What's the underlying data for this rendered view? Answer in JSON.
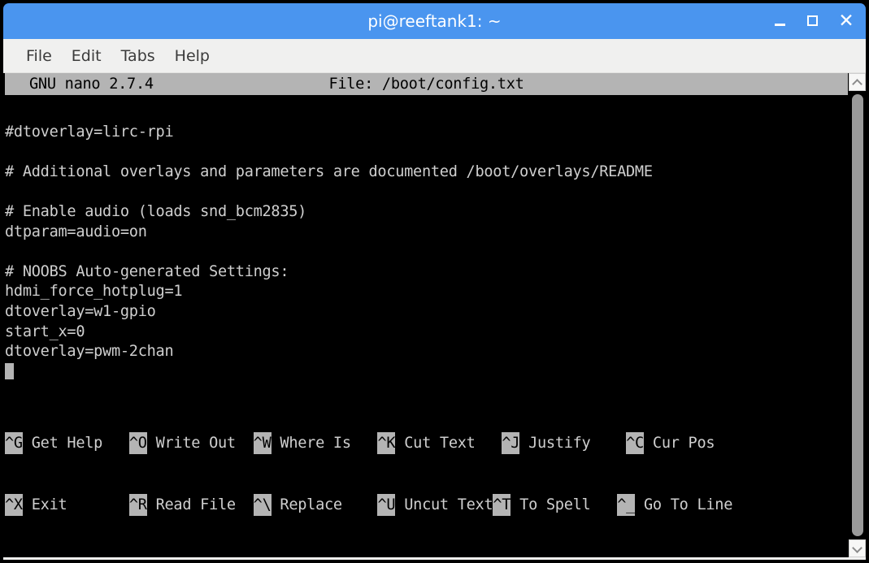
{
  "window": {
    "title": "pi@reeftank1: ~",
    "controls": [
      {
        "name": "minimize",
        "glyph": "_"
      },
      {
        "name": "maximize",
        "glyph": "□"
      },
      {
        "name": "close",
        "glyph": "✕"
      }
    ],
    "accent_color": "#4a95ef",
    "menubar_color": "#f0f0ef",
    "terminal_bg": "#000000",
    "terminal_fg": "#cfcfcf",
    "inverted_bg": "#b4b4b4"
  },
  "menu": {
    "items": [
      {
        "label": "File"
      },
      {
        "label": "Edit"
      },
      {
        "label": "Tabs"
      },
      {
        "label": "Help"
      }
    ]
  },
  "nano": {
    "version": "GNU nano 2.7.4",
    "file_label": "File: /boot/config.txt",
    "lines": [
      "",
      "#dtoverlay=lirc-rpi",
      "",
      "# Additional overlays and parameters are documented /boot/overlays/README",
      "",
      "# Enable audio (loads snd_bcm2835)",
      "dtparam=audio=on",
      "",
      "# NOOBS Auto-generated Settings:",
      "hdmi_force_hotplug=1",
      "dtoverlay=w1-gpio",
      "start_x=0",
      "dtoverlay=pwm-2chan"
    ],
    "cursor": {
      "line_index": 13,
      "column": 0
    },
    "shortcuts": {
      "row1": [
        {
          "key": "^G",
          "label": " Get Help   "
        },
        {
          "key": "^O",
          "label": " Write Out  "
        },
        {
          "key": "^W",
          "label": " Where Is   "
        },
        {
          "key": "^K",
          "label": " Cut Text   "
        },
        {
          "key": "^J",
          "label": " Justify    "
        },
        {
          "key": "^C",
          "label": " Cur Pos"
        }
      ],
      "row2": [
        {
          "key": "^X",
          "label": " Exit       "
        },
        {
          "key": "^R",
          "label": " Read File  "
        },
        {
          "key": "^\\",
          "label": " Replace    "
        },
        {
          "key": "^U",
          "label": " Uncut Text"
        },
        {
          "key": "^T",
          "label": " To Spell   "
        },
        {
          "key": "^_",
          "label": " Go To Line"
        }
      ]
    }
  },
  "scrollbar": {
    "up_arrow": "▲",
    "down_arrow": "▼"
  }
}
